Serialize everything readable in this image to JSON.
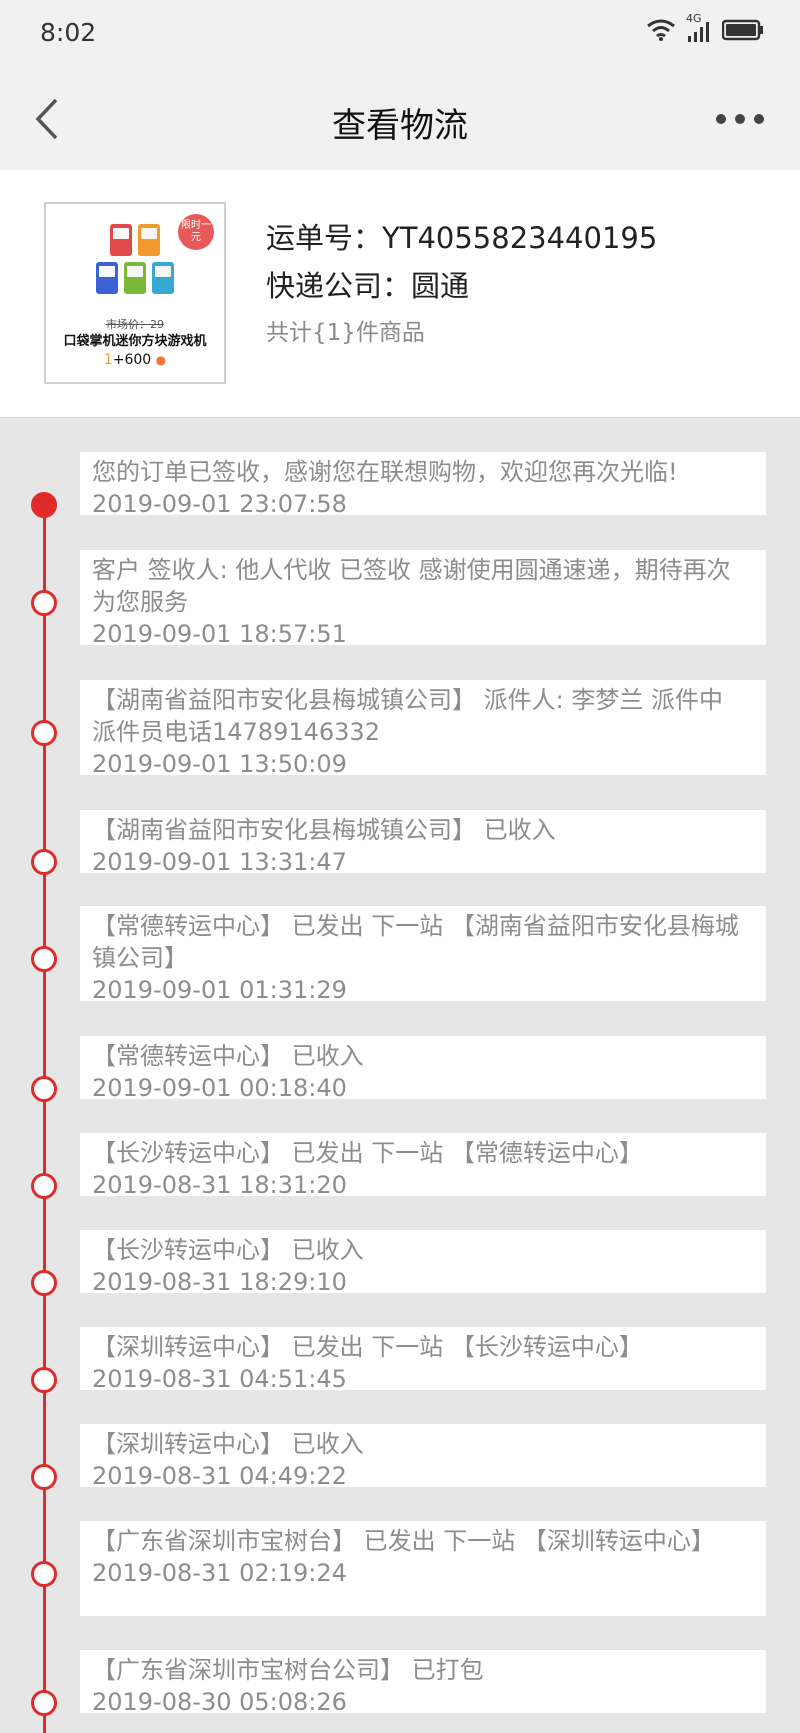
{
  "status_bar": {
    "time": "8:02",
    "icons": [
      "wifi-icon",
      "4g-signal-icon",
      "battery-icon"
    ],
    "network_label": "4G"
  },
  "nav": {
    "title": "查看物流",
    "back_icon": "chevron-left-icon",
    "more_icon": "more-dots-icon"
  },
  "product": {
    "promo_badge": "限时一元",
    "market_price": "市场价：29",
    "name": "口袋掌机迷你方块游戏机",
    "price_prefix": "1",
    "price_suffix": "+600",
    "tracking_label": "运单号：",
    "tracking_number": "YT4055823440195",
    "courier_label": "快递公司：",
    "courier_name": "圆通",
    "item_count": "共计{1}件商品"
  },
  "events": [
    {
      "desc": "您的订单已签收，感谢您在联想购物，欢迎您再次光临!",
      "time": "2019-09-01 23:07:58",
      "active": true
    },
    {
      "desc": "客户 签收人: 他人代收 已签收 感谢使用圆通速递，期待再次为您服务",
      "time": "2019-09-01 18:57:51",
      "active": false
    },
    {
      "desc": "【湖南省益阳市安化县梅城镇公司】 派件人: 李梦兰 派件中 派件员电话14789146332",
      "time": "2019-09-01 13:50:09",
      "active": false
    },
    {
      "desc": "【湖南省益阳市安化县梅城镇公司】 已收入",
      "time": "2019-09-01 13:31:47",
      "active": false
    },
    {
      "desc": "【常德转运中心】 已发出 下一站 【湖南省益阳市安化县梅城镇公司】",
      "time": "2019-09-01 01:31:29",
      "active": false
    },
    {
      "desc": "【常德转运中心】 已收入",
      "time": "2019-09-01 00:18:40",
      "active": false
    },
    {
      "desc": "【长沙转运中心】 已发出 下一站 【常德转运中心】",
      "time": "2019-08-31 18:31:20",
      "active": false
    },
    {
      "desc": "【长沙转运中心】 已收入",
      "time": "2019-08-31 18:29:10",
      "active": false
    },
    {
      "desc": "【深圳转运中心】 已发出 下一站 【长沙转运中心】",
      "time": "2019-08-31 04:51:45",
      "active": false
    },
    {
      "desc": "【深圳转运中心】 已收入",
      "time": "2019-08-31 04:49:22",
      "active": false
    },
    {
      "desc": "【广东省深圳市宝树台】 已发出 下一站 【深圳转运中心】",
      "time": "2019-08-31 02:19:24",
      "active": false
    },
    {
      "desc": "【广东省深圳市宝树台公司】 已打包",
      "time": "2019-08-30 05:08:26",
      "active": false
    }
  ],
  "colors": {
    "accent": "#e12b2b",
    "background": "#e6e6e6",
    "muted_text": "#8d8d8d"
  }
}
